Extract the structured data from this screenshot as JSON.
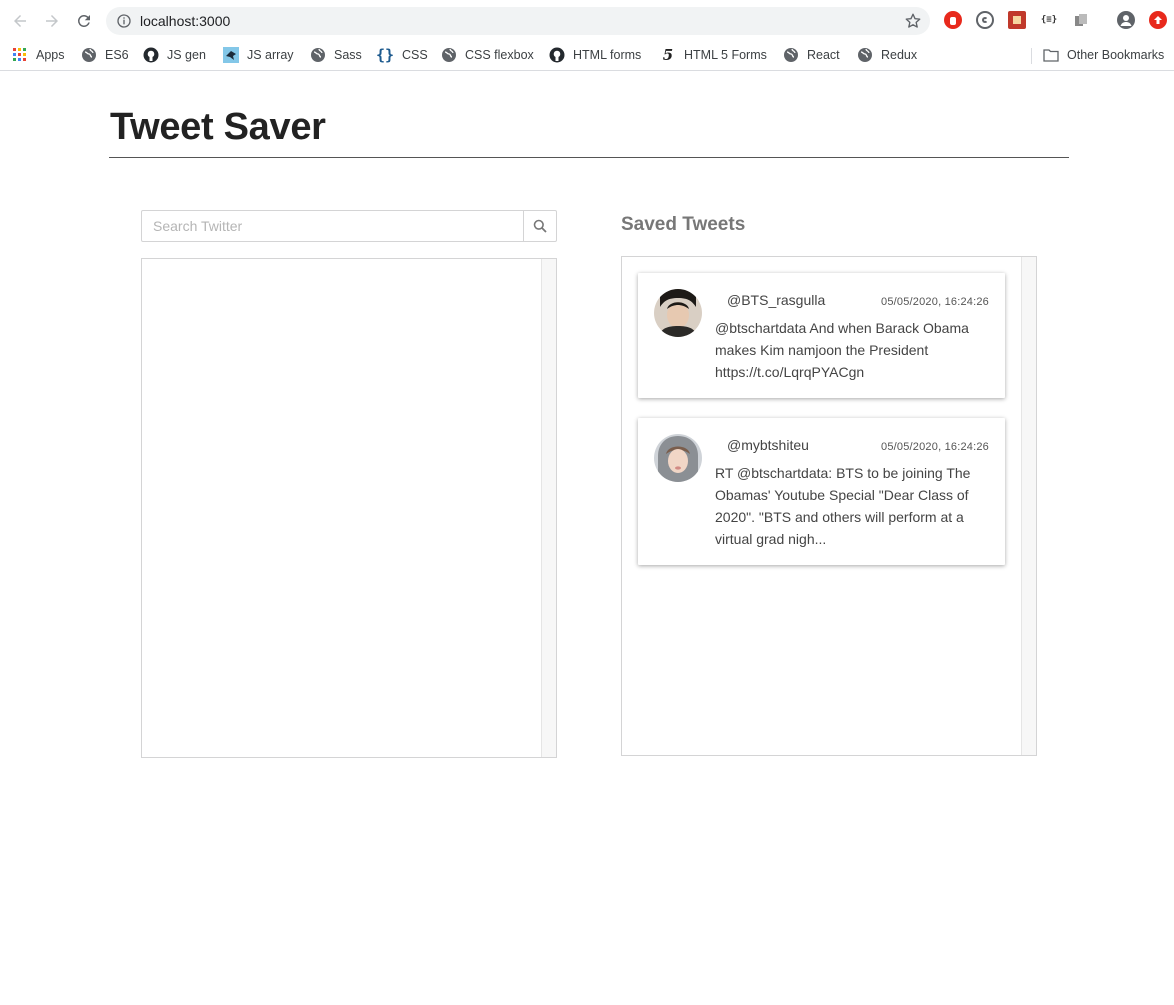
{
  "browser": {
    "url": "localhost:3000",
    "bookmarks": [
      {
        "label": "Apps",
        "icon": "apps-grid-icon"
      },
      {
        "label": "ES6",
        "icon": "globe-icon"
      },
      {
        "label": "JS gen",
        "icon": "github-icon"
      },
      {
        "label": "JS array",
        "icon": "bird-icon"
      },
      {
        "label": "Sass",
        "icon": "globe-icon"
      },
      {
        "label": "CSS",
        "icon": "braces-icon"
      },
      {
        "label": "CSS flexbox",
        "icon": "globe-icon"
      },
      {
        "label": "HTML forms",
        "icon": "github-icon"
      },
      {
        "label": "HTML 5 Forms",
        "icon": "html5-icon"
      },
      {
        "label": "React",
        "icon": "globe-icon"
      },
      {
        "label": "Redux",
        "icon": "globe-icon"
      }
    ],
    "other_bookmarks": "Other Bookmarks"
  },
  "page": {
    "title": "Tweet Saver"
  },
  "search": {
    "placeholder": "Search Twitter",
    "value": ""
  },
  "saved": {
    "heading": "Saved Tweets",
    "tweets": [
      {
        "handle": "@BTS_rasgulla",
        "timestamp": "05/05/2020, 16:24:26",
        "text": "@btschartdata And when Barack Obama makes Kim namjoon the President https://t.co/LqrqPYACgn"
      },
      {
        "handle": "@mybtshiteu",
        "timestamp": "05/05/2020, 16:24:26",
        "text": "RT @btschartdata: BTS to be joining The Obamas' Youtube Special \"Dear Class of 2020\". \"BTS and others will perform at a virtual grad nigh..."
      }
    ]
  },
  "colors": {
    "ext_red": "#e8291c",
    "bookmark_text": "#3c4043"
  }
}
